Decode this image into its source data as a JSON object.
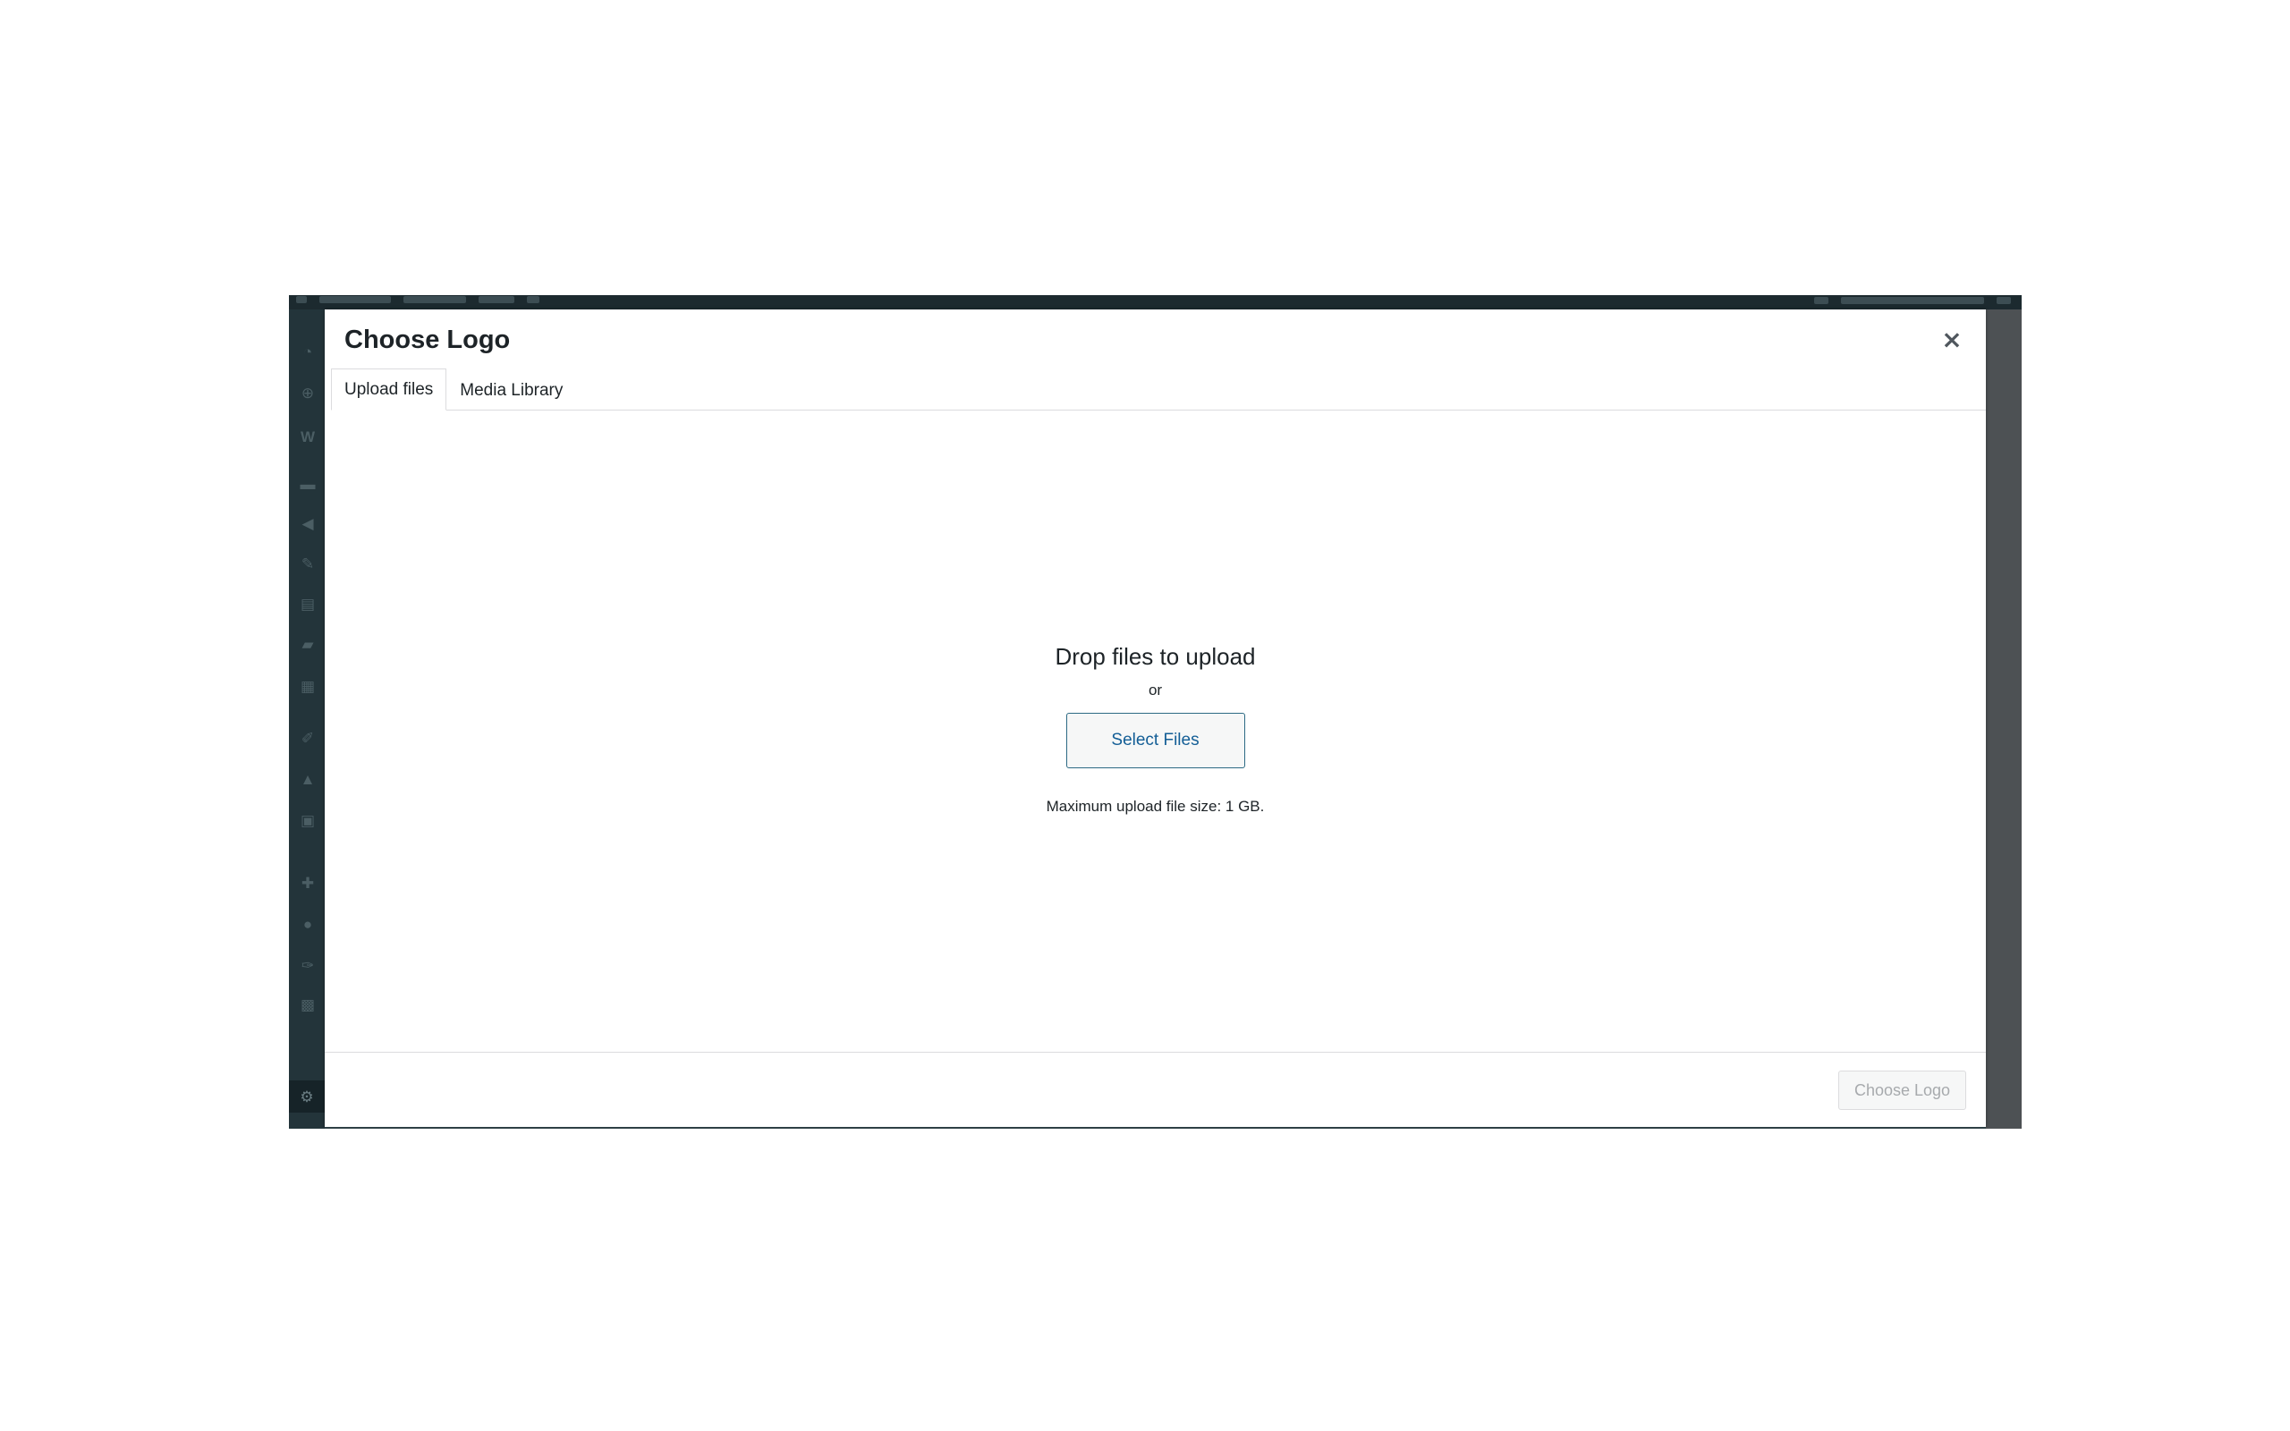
{
  "modal": {
    "title": "Choose Logo",
    "close_label": "×",
    "tabs": [
      {
        "label": "Upload files",
        "active": true
      },
      {
        "label": "Media Library",
        "active": false
      }
    ],
    "upload": {
      "drop_text": "Drop files to upload",
      "or_text": "or",
      "select_button": "Select Files",
      "max_size_text": "Maximum upload file size: 1 GB."
    },
    "footer": {
      "choose_button": "Choose Logo",
      "choose_button_disabled": true
    }
  },
  "sidebar": {
    "icons": [
      "dashboard-icon",
      "updates-icon",
      "woocommerce-icon",
      "products-icon",
      "marketing-icon",
      "posts-icon",
      "pages-icon",
      "comments-icon",
      "templates-icon",
      "appearance-icon",
      "courses-icon",
      "lessons-icon",
      "plugins-icon",
      "users-icon",
      "tools-icon",
      "blocks-icon",
      "settings-icon"
    ],
    "active": "settings-icon"
  },
  "colors": {
    "admin_dark": "#23343a",
    "accent": "#135e96",
    "text": "#1d2327",
    "border": "#dcdcde",
    "disabled_text": "#a7aaad"
  }
}
